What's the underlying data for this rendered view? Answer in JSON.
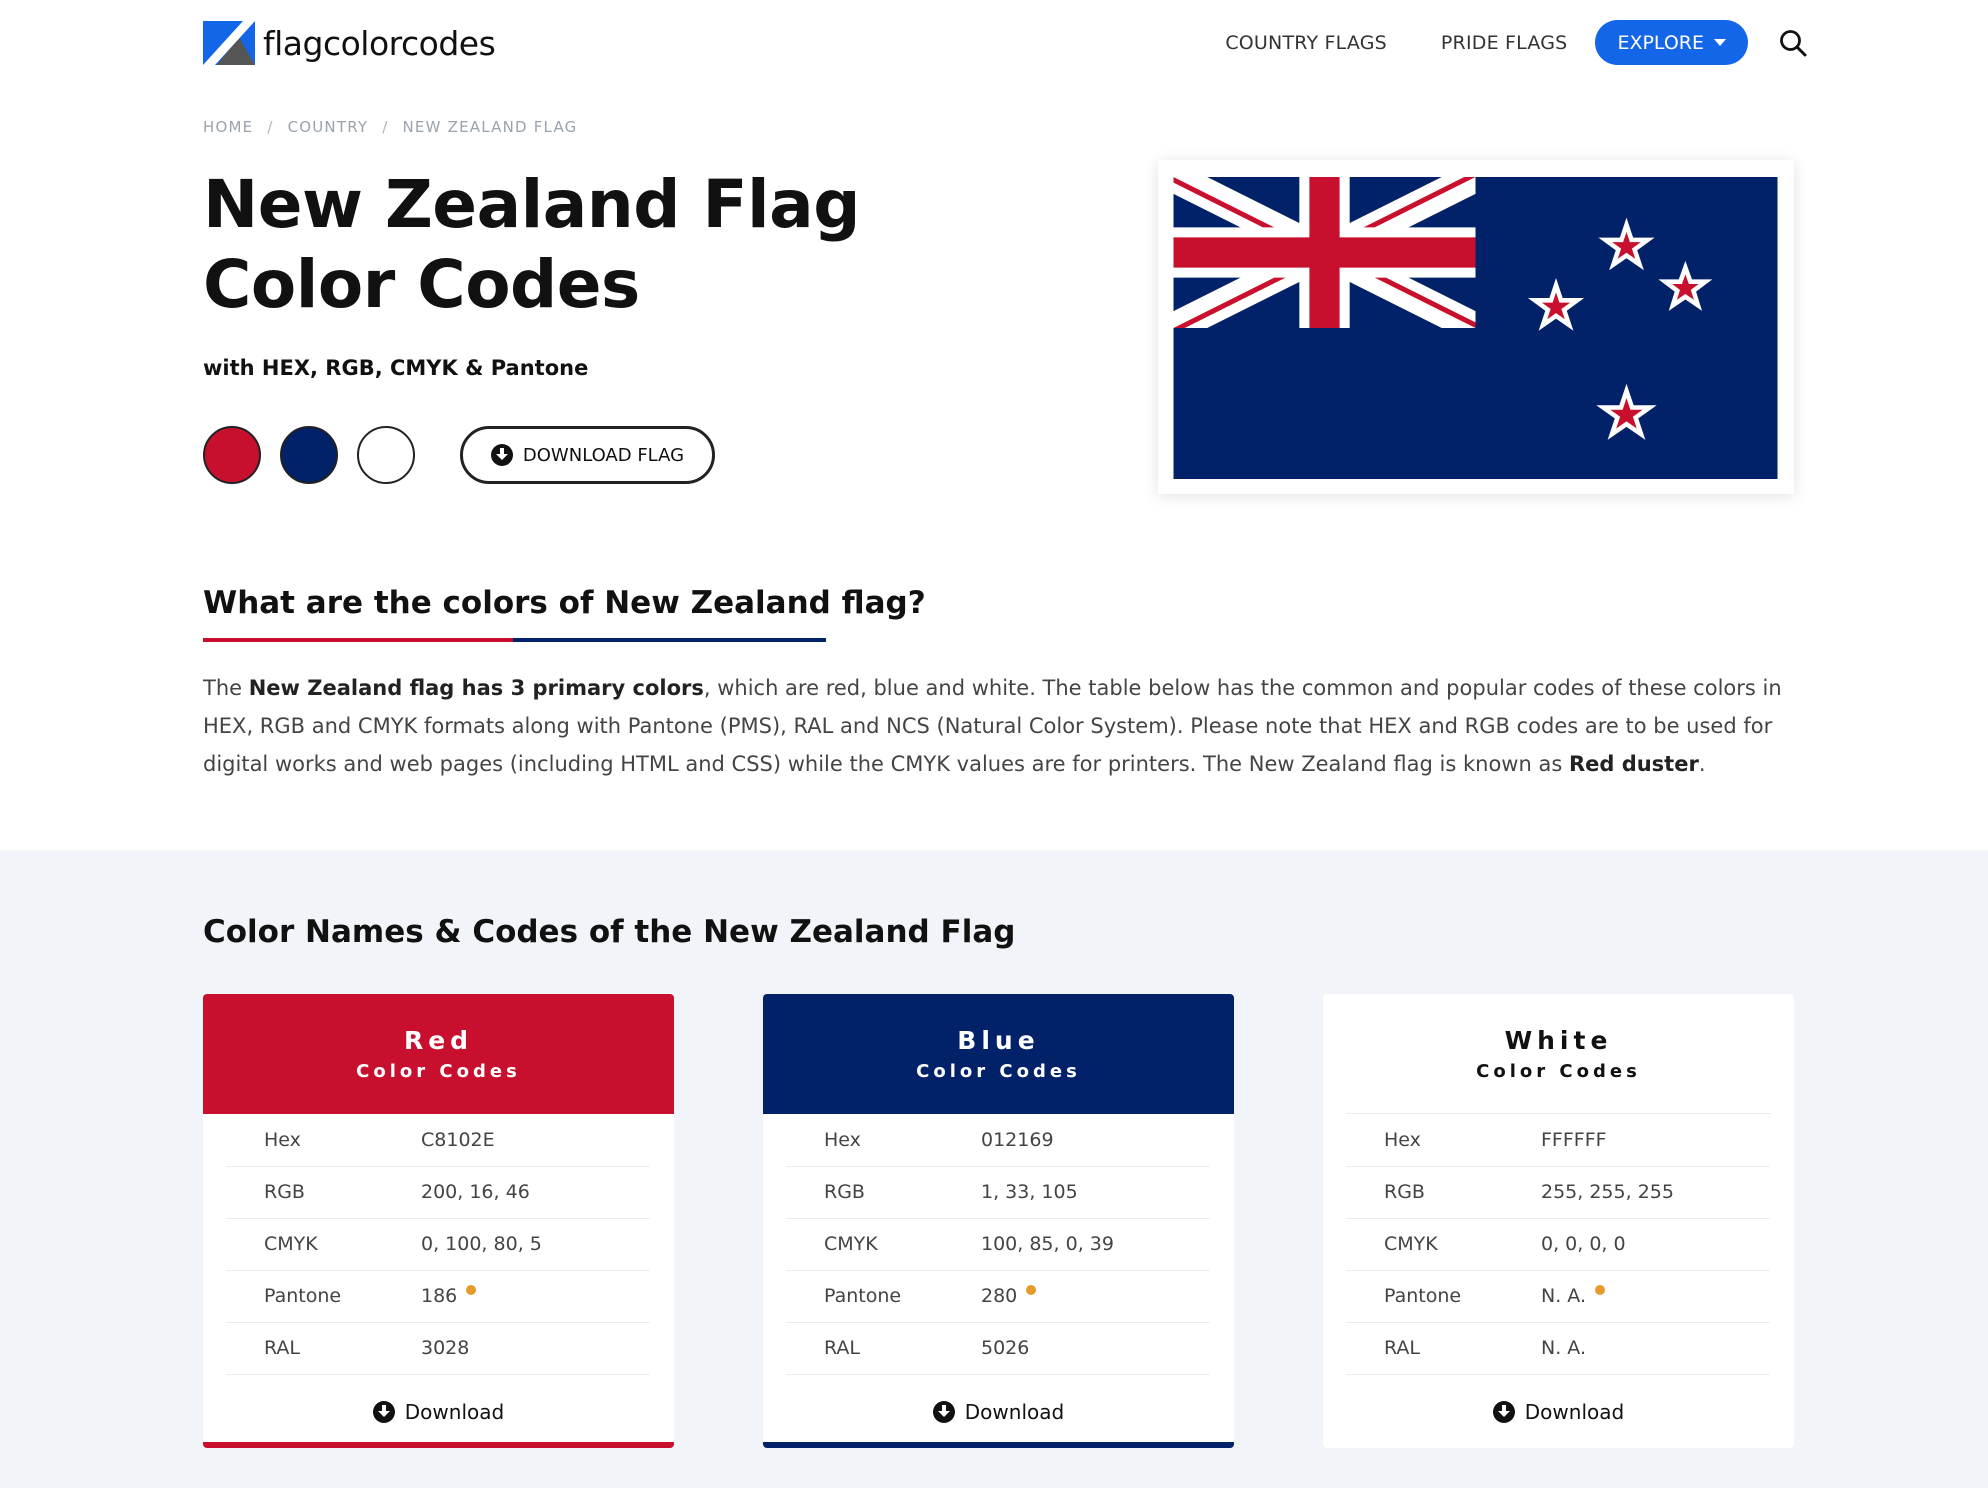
{
  "header": {
    "logo_text": "flagcolorcodes",
    "nav": [
      "COUNTRY FLAGS",
      "PRIDE FLAGS"
    ],
    "explore_label": "EXPLORE"
  },
  "breadcrumb": [
    "HOME",
    "COUNTRY",
    "NEW ZEALAND FLAG"
  ],
  "hero": {
    "title": "New Zealand Flag Color Codes",
    "subtitle": "with HEX, RGB, CMYK & Pantone",
    "download_label": "DOWNLOAD FLAG",
    "swatch_colors": [
      "#C8102E",
      "#012169",
      "#FFFFFF"
    ]
  },
  "about": {
    "heading": "What are the colors of New Zealand flag?",
    "para_1": "The ",
    "para_bold_1": "New Zealand flag has 3 primary colors",
    "para_2": ", which are red, blue and white. The table below has the common and popular codes of these colors in HEX, RGB and CMYK formats along with Pantone (PMS), RAL and NCS (Natural Color System). Please note that HEX and RGB codes are to be used for digital works and web pages (including HTML and CSS) while the CMYK values are for printers. The New Zealand flag is known as ",
    "para_bold_2": "Red duster",
    "para_3": "."
  },
  "codes_section": {
    "heading": "Color Names & Codes of the New Zealand Flag",
    "row_labels": [
      "Hex",
      "RGB",
      "CMYK",
      "Pantone",
      "RAL"
    ],
    "download_label": "Download",
    "cards": [
      {
        "title": "Red",
        "subtitle": "Color Codes",
        "hex": "C8102E",
        "rgb": "200, 16, 46",
        "cmyk": "0, 100, 80, 5",
        "pantone": "186",
        "ral": "3028",
        "color": "#C8102E"
      },
      {
        "title": "Blue",
        "subtitle": "Color Codes",
        "hex": "012169",
        "rgb": "1, 33, 105",
        "cmyk": "100, 85, 0, 39",
        "pantone": "280",
        "ral": "5026",
        "color": "#012169"
      },
      {
        "title": "White",
        "subtitle": "Color Codes",
        "hex": "FFFFFF",
        "rgb": "255, 255, 255",
        "cmyk": "0, 0, 0, 0",
        "pantone": "N. A.",
        "ral": "N. A.",
        "color": "#FFFFFF"
      }
    ]
  }
}
